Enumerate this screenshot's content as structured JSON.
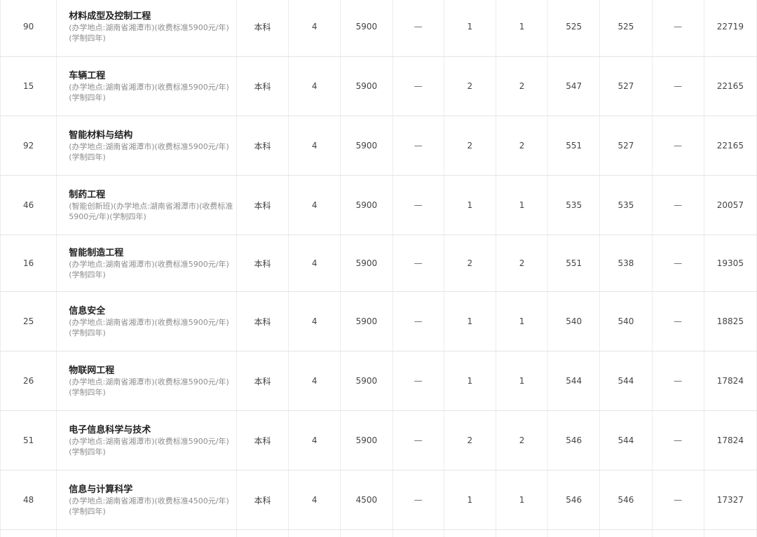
{
  "rows": [
    {
      "code": "90",
      "name": "材料成型及控制工程",
      "note": "(办学地点:湖南省湘潭市)(收费标准5900元/年)(学制四年)",
      "level": "本科",
      "years": "4",
      "fee": "5900",
      "c6": "—",
      "c7": "1",
      "c8": "1",
      "high": "525",
      "low": "525",
      "c11": "—",
      "rank": "22719"
    },
    {
      "code": "15",
      "name": "车辆工程",
      "note": "(办学地点:湖南省湘潭市)(收费标准5900元/年)(学制四年)",
      "level": "本科",
      "years": "4",
      "fee": "5900",
      "c6": "—",
      "c7": "2",
      "c8": "2",
      "high": "547",
      "low": "527",
      "c11": "—",
      "rank": "22165"
    },
    {
      "code": "92",
      "name": "智能材料与结构",
      "note": "(办学地点:湖南省湘潭市)(收费标准5900元/年)(学制四年)",
      "level": "本科",
      "years": "4",
      "fee": "5900",
      "c6": "—",
      "c7": "2",
      "c8": "2",
      "high": "551",
      "low": "527",
      "c11": "—",
      "rank": "22165"
    },
    {
      "code": "46",
      "name": "制药工程",
      "note": "(智能创新班)(办学地点:湖南省湘潭市)(收费标准5900元/年)(学制四年)",
      "level": "本科",
      "years": "4",
      "fee": "5900",
      "c6": "—",
      "c7": "1",
      "c8": "1",
      "high": "535",
      "low": "535",
      "c11": "—",
      "rank": "20057"
    },
    {
      "code": "16",
      "name": "智能制造工程",
      "note": "(办学地点:湖南省湘潭市)(收费标准5900元/年)(学制四年)",
      "level": "本科",
      "years": "4",
      "fee": "5900",
      "c6": "—",
      "c7": "2",
      "c8": "2",
      "high": "551",
      "low": "538",
      "c11": "—",
      "rank": "19305"
    },
    {
      "code": "25",
      "name": "信息安全",
      "note": "(办学地点:湖南省湘潭市)(收费标准5900元/年)(学制四年)",
      "level": "本科",
      "years": "4",
      "fee": "5900",
      "c6": "—",
      "c7": "1",
      "c8": "1",
      "high": "540",
      "low": "540",
      "c11": "—",
      "rank": "18825"
    },
    {
      "code": "26",
      "name": "物联网工程",
      "note": "(办学地点:湖南省湘潭市)(收费标准5900元/年)(学制四年)",
      "level": "本科",
      "years": "4",
      "fee": "5900",
      "c6": "—",
      "c7": "1",
      "c8": "1",
      "high": "544",
      "low": "544",
      "c11": "—",
      "rank": "17824"
    },
    {
      "code": "51",
      "name": "电子信息科学与技术",
      "note": "(办学地点:湖南省湘潭市)(收费标准5900元/年)(学制四年)",
      "level": "本科",
      "years": "4",
      "fee": "5900",
      "c6": "—",
      "c7": "2",
      "c8": "2",
      "high": "546",
      "low": "544",
      "c11": "—",
      "rank": "17824"
    },
    {
      "code": "48",
      "name": "信息与计算科学",
      "note": "(办学地点:湖南省湘潭市)(收费标准4500元/年)(学制四年)",
      "level": "本科",
      "years": "4",
      "fee": "4500",
      "c6": "—",
      "c7": "1",
      "c8": "1",
      "high": "546",
      "low": "546",
      "c11": "—",
      "rank": "17327"
    }
  ]
}
